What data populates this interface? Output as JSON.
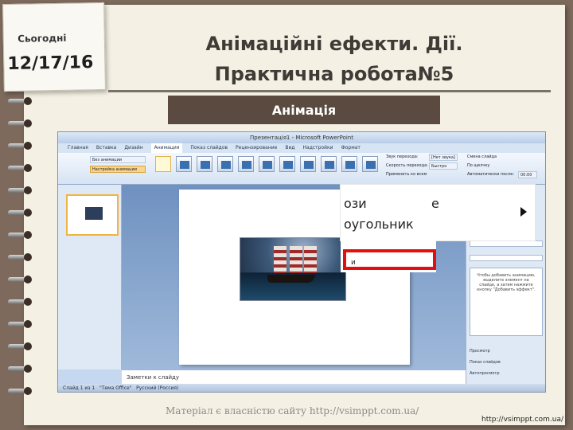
{
  "date_note": {
    "label": "Сьогодні",
    "date": "12/17/16"
  },
  "title": {
    "line1": "Анімаційні ефекти. Дії.",
    "line2": "Практична робота№5"
  },
  "banner": "Анімація",
  "ppt": {
    "window_title": "Презентація1 - Microsoft PowerPoint",
    "tabs": [
      "Главная",
      "Вставка",
      "Дизайн",
      "Анимация",
      "Показ слайдов",
      "Рецензирование",
      "Вид",
      "Надстройки",
      "Формат"
    ],
    "active_tab": "Анимация",
    "animation_select": "Без анимации",
    "setup_animation_button": "Настройка анимации",
    "ribbon_right": {
      "sound_label": "Звук перехода:",
      "sound_value": "[Нет звука]",
      "speed_label": "Скорость перехода:",
      "speed_value": "Быстро",
      "apply_all": "Применить ко всем",
      "advance_label": "Смена слайда",
      "on_click": "По щелчку",
      "auto_after": "Автоматически после:",
      "auto_time": "00:00"
    },
    "notes_placeholder": "Заметки к слайду",
    "status_slide": "Слайд 1 из 1",
    "status_theme": "\"Тема Office\"",
    "status_lang": "Русский (Россия)",
    "pane": {
      "hint": "Чтобы добавить анимацию, выделите элемент на слайде, а затем нажмите кнопку \"Добавить эффект\".",
      "play": "Просмотр",
      "slideshow": "Показ слайдов",
      "autopreview": "Автопросмотр"
    }
  },
  "zoom": {
    "line1": "ози",
    "letter": "е",
    "line2": "оугольник",
    "boxed_text": "и"
  },
  "footer": {
    "attribution": "Матеріал є власністю сайту http://vsimppt.com.ua/",
    "url": "http://vsimppt.com.ua/"
  }
}
